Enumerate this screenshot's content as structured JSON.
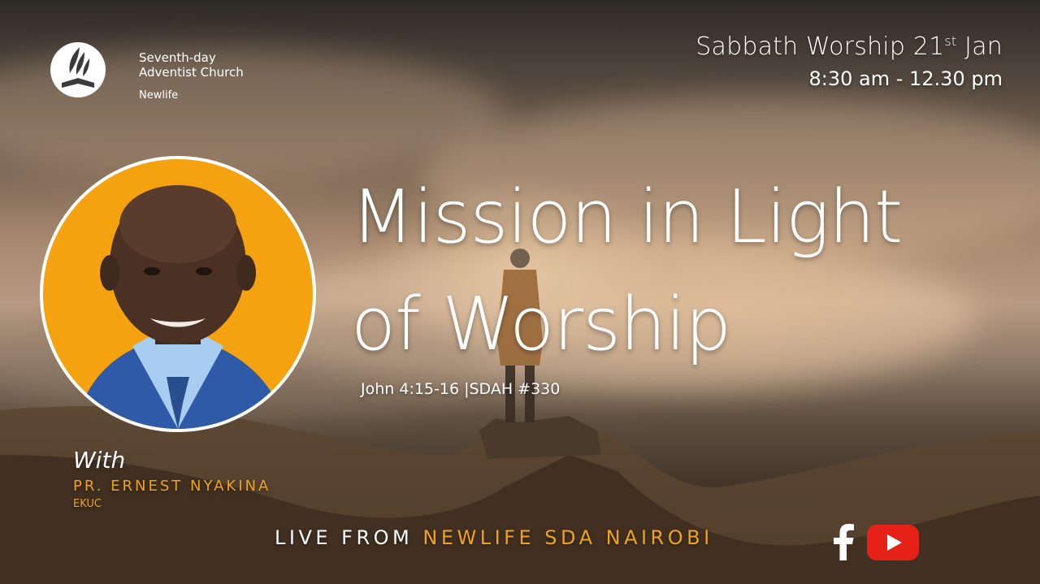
{
  "org": {
    "line1": "Seventh-day",
    "line2": "Adventist Church",
    "sub": "Newlife"
  },
  "event": {
    "title": "Sabbath Worship 21",
    "title_sup": "st",
    "title_end": " Jan",
    "time": "8:30 am - 12.30 pm"
  },
  "sermon": {
    "title_line1": "Mission in Light",
    "title_line2": "of Worship",
    "scripture": "John 4:15-16 |SDAH #330"
  },
  "speaker": {
    "with_label": "With",
    "name": "PR. ERNEST NYAKINA",
    "org": "EKUC"
  },
  "live": {
    "prefix": "LIVE FROM ",
    "place": "NEWLIFE SDA NAIROBI"
  },
  "icons": {
    "logo": "adventist-flame-bible-icon",
    "facebook": "facebook-icon",
    "youtube": "youtube-icon"
  },
  "colors": {
    "accent": "#f0a218",
    "portrait_bg": "#f4a20f",
    "youtube_red": "#e62117"
  }
}
